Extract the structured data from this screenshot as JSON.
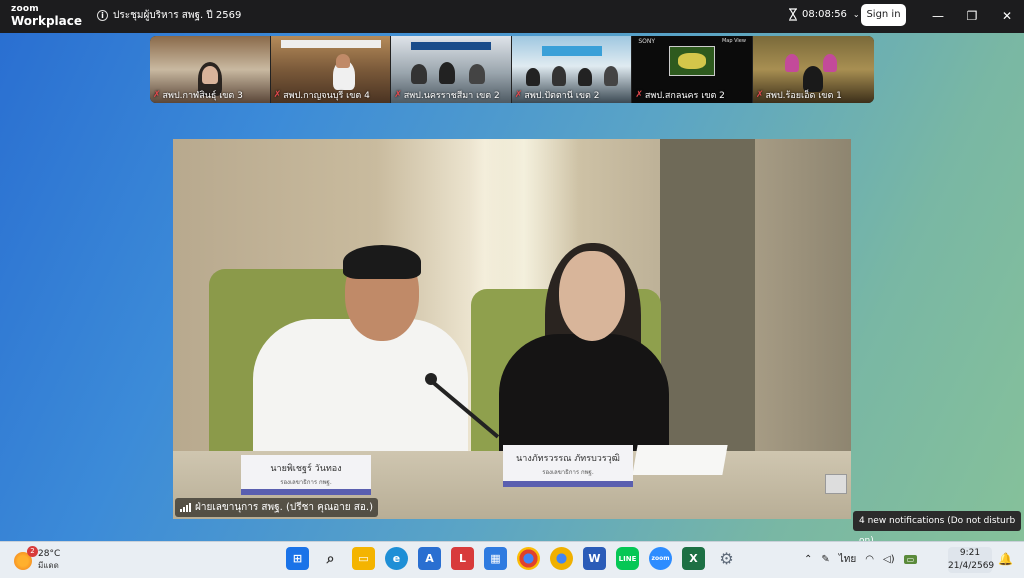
{
  "app": {
    "brand_line1": "zoom",
    "brand_line2": "Workplace"
  },
  "meeting": {
    "title": "ประชุมผู้บริหาร สพฐ. ปี 2569",
    "timer": "08:08:56"
  },
  "titlebar": {
    "sign_in_label": "Sign in"
  },
  "gallery": {
    "tiles": [
      {
        "label": "สพป.กาฬสินธุ์ เขต 3"
      },
      {
        "label": "สพป.กาญจนบุรี เขต 4"
      },
      {
        "label": "สพป.นครราชสีมา เขต 2"
      },
      {
        "label": "สพป.ปัตตานี เขต 2"
      },
      {
        "label": "สพป.สกลนคร เขต 2",
        "screen_left": "SONY",
        "screen_right": "Map View"
      },
      {
        "label": "สพป.ร้อยเอ็ด เขต 1"
      }
    ]
  },
  "main_video": {
    "label": "ฝ่ายเลขานุการ สพฐ. (ปรีชา คุณอาย สอ.)",
    "nameplate_left": {
      "name": "นายพิเชฐร์ วันทอง",
      "role": "รองเลขาธิการ กพฐ."
    },
    "nameplate_right": {
      "name": "นางภัทรวรรณ ภัทรบวรวุฒิ",
      "role": "รองเลขาธิการ กพฐ."
    }
  },
  "notification": {
    "text": "4 new notifications (Do not disturb on)"
  },
  "taskbar": {
    "weather": {
      "temp": "28°C",
      "condition": "มีแดด",
      "badge": "2"
    },
    "apps": [
      {
        "icon": "windows-start-icon",
        "color": "#1a73e8"
      },
      {
        "icon": "search-icon",
        "color": "#333333"
      },
      {
        "icon": "file-explorer-icon",
        "color": "#f4b400"
      },
      {
        "icon": "edge-icon",
        "color": "#1e8fd6"
      },
      {
        "icon": "app-a-icon",
        "color": "#2a6fd1"
      },
      {
        "icon": "app-l-icon",
        "color": "#d83b3b"
      },
      {
        "icon": "store-icon",
        "color": "#2f7be0"
      },
      {
        "icon": "chrome-icon",
        "color": "#e0412c"
      },
      {
        "icon": "chrome-canary-icon",
        "color": "#f0b000"
      },
      {
        "icon": "word-icon",
        "color": "#2b5cb8"
      },
      {
        "icon": "line-icon",
        "color": "#06c755"
      },
      {
        "icon": "zoom-icon",
        "color": "#2d8cff"
      },
      {
        "icon": "excel-icon",
        "color": "#1d7044"
      },
      {
        "icon": "settings-icon",
        "color": "#5f6b7a"
      }
    ],
    "tray": {
      "lang": "ไทย"
    },
    "clock": {
      "time": "9:21",
      "date": "21/4/2569"
    }
  }
}
